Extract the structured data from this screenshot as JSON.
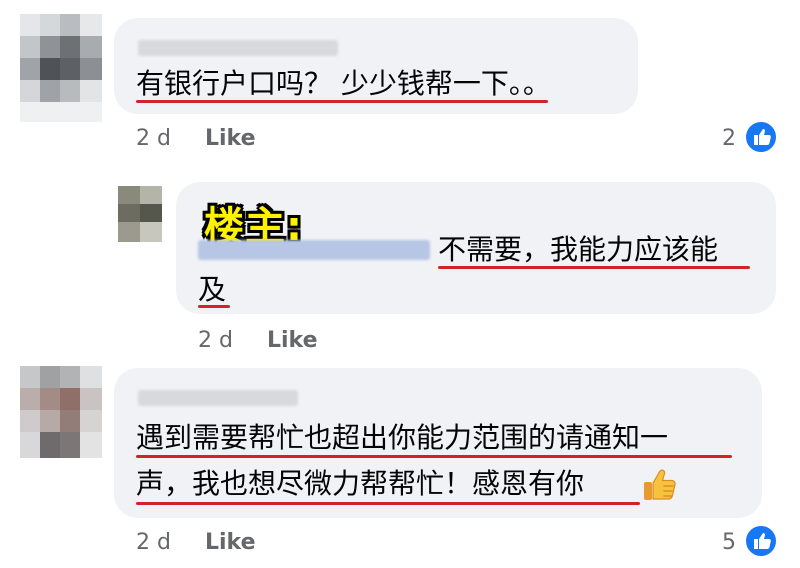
{
  "comments": [
    {
      "text": "有银行户口吗？ 少少钱帮一下。。",
      "time": "2 d",
      "like_label": "Like",
      "reactions": "2"
    },
    {
      "op_tag": "楼主:",
      "line1": "不需要，我能力应该能",
      "line2": "及",
      "time": "2 d",
      "like_label": "Like"
    },
    {
      "line1": "遇到需要帮忙也超出你能力范围的请通知一",
      "line2": "声，我也想尽微力帮帮忙！感恩有你",
      "time": "2 d",
      "like_label": "Like",
      "reactions": "5"
    }
  ],
  "colors": {
    "bubble": "#f0f2f5",
    "underline": "#d2232a",
    "meta": "#65676b",
    "like_blue": "#1877f2",
    "op_tag": "#fff200"
  },
  "icons": [
    "thumbs-up-reaction-icon",
    "thumbs-up-emoji-icon"
  ]
}
